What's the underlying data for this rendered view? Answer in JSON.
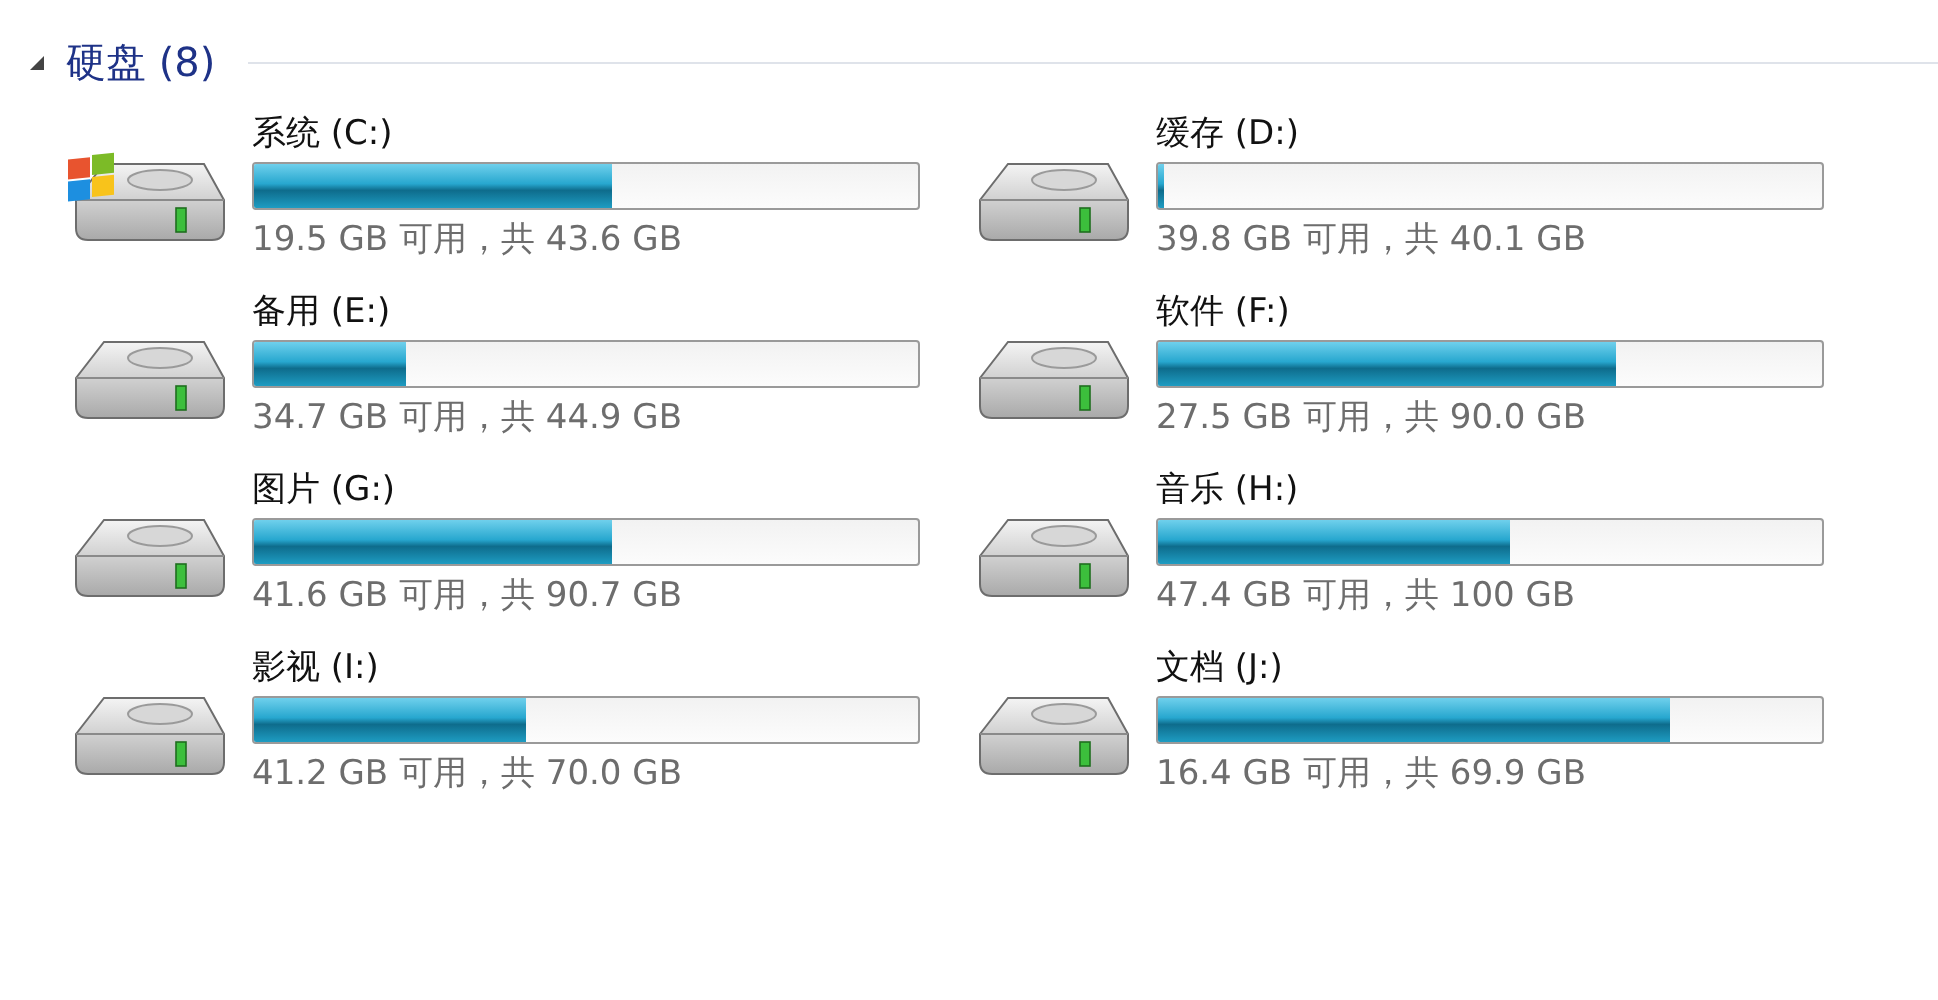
{
  "group": {
    "title": "硬盘 (8)",
    "expanded": true
  },
  "drives": [
    {
      "name": "系统 (C:)",
      "kind": "system",
      "level": 0.54,
      "space": "19.5 GB 可用，共 43.6 GB"
    },
    {
      "name": "缓存 (D:)",
      "kind": "plain",
      "level": 0.01,
      "space": "39.8 GB 可用，共 40.1 GB"
    },
    {
      "name": "备用 (E:)",
      "kind": "plain",
      "level": 0.23,
      "space": "34.7 GB 可用，共 44.9 GB"
    },
    {
      "name": "软件 (F:)",
      "kind": "plain",
      "level": 0.69,
      "space": "27.5 GB 可用，共 90.0 GB"
    },
    {
      "name": "图片 (G:)",
      "kind": "plain",
      "level": 0.54,
      "space": "41.6 GB 可用，共 90.7 GB"
    },
    {
      "name": "音乐 (H:)",
      "kind": "plain",
      "level": 0.53,
      "space": "47.4 GB 可用，共 100 GB"
    },
    {
      "name": "影视 (I:)",
      "kind": "plain",
      "level": 0.41,
      "space": "41.2 GB 可用，共 70.0 GB"
    },
    {
      "name": "文档 (J:)",
      "kind": "plain",
      "level": 0.77,
      "space": "16.4 GB 可用，共 69.9 GB"
    }
  ]
}
